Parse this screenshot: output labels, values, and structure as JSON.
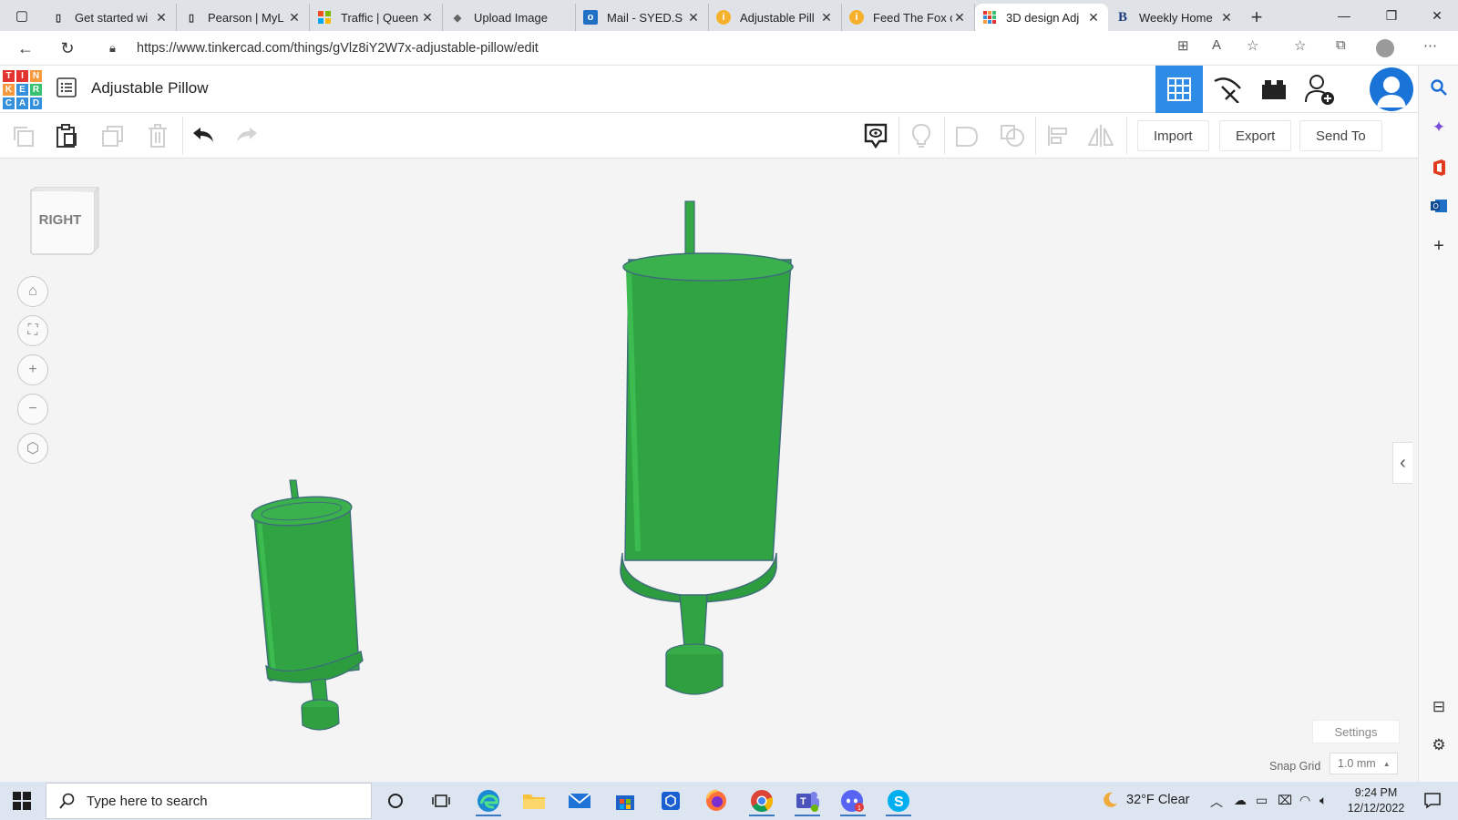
{
  "browser": {
    "tabs": [
      {
        "title": "Get started wi",
        "favicon": "page-icon"
      },
      {
        "title": "Pearson | MyL",
        "favicon": "page-icon"
      },
      {
        "title": "Traffic | Queen",
        "favicon": "microsoft-icon"
      },
      {
        "title": "Upload Image",
        "favicon": "upload-icon"
      },
      {
        "title": "Mail - SYED.S",
        "favicon": "outlook-icon"
      },
      {
        "title": "Adjustable Pill",
        "favicon": "instructables-icon"
      },
      {
        "title": "Feed The Fox c",
        "favicon": "instructables-icon"
      },
      {
        "title": "3D design Adj",
        "favicon": "tinkercad-icon",
        "active": true
      },
      {
        "title": "Weekly Home",
        "favicon": "b-icon"
      }
    ],
    "url": "https://www.tinkercad.com/things/gVlz8iY2W7x-adjustable-pillow/edit"
  },
  "app": {
    "logo_letters": [
      "T",
      "I",
      "N",
      "K",
      "E",
      "R",
      "C",
      "A",
      "D"
    ],
    "design_title": "Adjustable Pillow"
  },
  "toolbar": {
    "import_label": "Import",
    "export_label": "Export",
    "send_to_label": "Send To"
  },
  "workplane": {
    "viewcube_face": "RIGHT",
    "settings_label": "Settings",
    "snap_grid_label": "Snap Grid",
    "snap_grid_value": "1.0 mm",
    "shape_color": "#2e9e3e"
  },
  "taskbar": {
    "search_placeholder": "Type here to search",
    "weather": "32°F  Clear",
    "time": "9:24 PM",
    "date": "12/12/2022"
  }
}
